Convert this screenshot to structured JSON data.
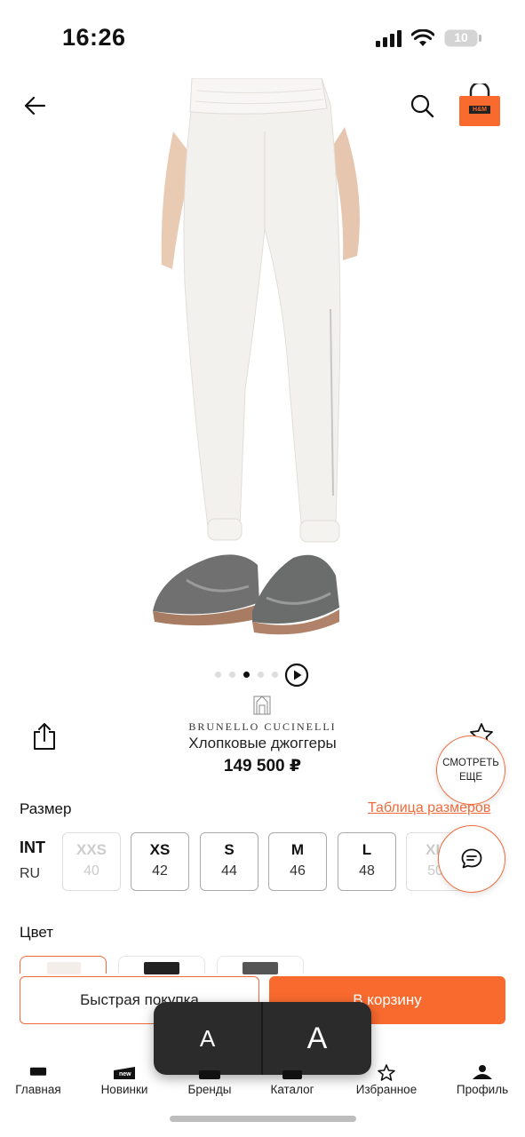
{
  "status_bar": {
    "time": "16:26",
    "battery": "10"
  },
  "header": {
    "bag_logo_text": "H&M"
  },
  "gallery": {
    "dots": 5,
    "active_index": 2
  },
  "product": {
    "brand": "BRUNELLO CUCINELLI",
    "title": "Хлопковые джоггеры",
    "price": "149 500 ₽"
  },
  "more_button": {
    "label": "СМОТРЕТЬ ЕЩЕ"
  },
  "size_section": {
    "label": "Размер",
    "size_table_link": "Таблица размеров",
    "int_label": "INT",
    "ru_label": "RU",
    "sizes": [
      {
        "int": "XXS",
        "ru": "40",
        "available": false
      },
      {
        "int": "XS",
        "ru": "42",
        "available": true
      },
      {
        "int": "S",
        "ru": "44",
        "available": true
      },
      {
        "int": "M",
        "ru": "46",
        "available": true
      },
      {
        "int": "L",
        "ru": "48",
        "available": true
      },
      {
        "int": "XL",
        "ru": "50",
        "available": false
      }
    ]
  },
  "color_section": {
    "label": "Цвет"
  },
  "actions": {
    "quick_buy": "Быстрая покупка",
    "add_to_cart": "В корзину"
  },
  "key_popup": {
    "small": "A",
    "large": "A"
  },
  "bottom_nav": [
    {
      "label": "Главная",
      "icon": "home-icon"
    },
    {
      "label": "Новинки",
      "icon": "new-icon"
    },
    {
      "label": "Бренды",
      "icon": "brands-icon"
    },
    {
      "label": "Каталог",
      "icon": "catalog-icon"
    },
    {
      "label": "Избранное",
      "icon": "star-icon"
    },
    {
      "label": "Профиль",
      "icon": "profile-icon"
    }
  ],
  "colors": {
    "accent": "#f96a2e",
    "accent_border": "#f06a3a"
  }
}
